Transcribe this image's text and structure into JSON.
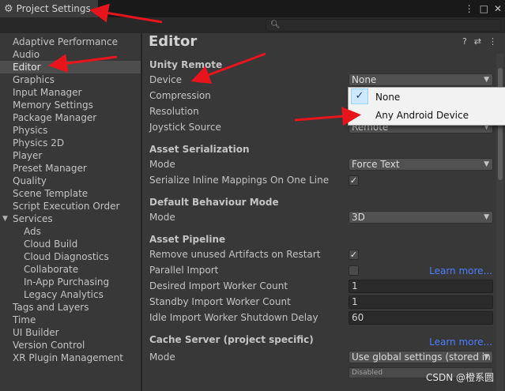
{
  "window": {
    "tab_title": "Project Settings",
    "gear_icon": "gear-icon"
  },
  "sidebar": {
    "items": [
      {
        "label": "Adaptive Performance"
      },
      {
        "label": "Audio"
      },
      {
        "label": "Editor",
        "selected": true
      },
      {
        "label": "Graphics"
      },
      {
        "label": "Input Manager"
      },
      {
        "label": "Memory Settings"
      },
      {
        "label": "Package Manager"
      },
      {
        "label": "Physics"
      },
      {
        "label": "Physics 2D"
      },
      {
        "label": "Player"
      },
      {
        "label": "Preset Manager"
      },
      {
        "label": "Quality"
      },
      {
        "label": "Scene Template"
      },
      {
        "label": "Script Execution Order"
      },
      {
        "label": "Services",
        "expanded": true
      },
      {
        "label": "Ads"
      },
      {
        "label": "Cloud Build"
      },
      {
        "label": "Cloud Diagnostics"
      },
      {
        "label": "Collaborate"
      },
      {
        "label": "In-App Purchasing"
      },
      {
        "label": "Legacy Analytics"
      },
      {
        "label": "Tags and Layers"
      },
      {
        "label": "Time"
      },
      {
        "label": "UI Builder"
      },
      {
        "label": "Version Control"
      },
      {
        "label": "XR Plugin Management"
      }
    ]
  },
  "main": {
    "title": "Editor",
    "unity_remote": {
      "header": "Unity Remote",
      "device_label": "Device",
      "device_value": "None",
      "compression_label": "Compression",
      "resolution_label": "Resolution",
      "joystick_label": "Joystick Source",
      "joystick_value": "Remote"
    },
    "asset_serialization": {
      "header": "Asset Serialization",
      "mode_label": "Mode",
      "mode_value": "Force Text",
      "inline_label": "Serialize Inline Mappings On One Line",
      "inline_checked": true
    },
    "default_behaviour": {
      "header": "Default Behaviour Mode",
      "mode_label": "Mode",
      "mode_value": "3D"
    },
    "asset_pipeline": {
      "header": "Asset Pipeline",
      "remove_label": "Remove unused Artifacts on Restart",
      "remove_checked": true,
      "parallel_label": "Parallel Import",
      "parallel_checked": false,
      "learn_more": "Learn more...",
      "desired_label": "Desired Import Worker Count",
      "desired_value": "1",
      "standby_label": "Standby Import Worker Count",
      "standby_value": "1",
      "idle_label": "Idle Import Worker Shutdown Delay",
      "idle_value": "60"
    },
    "cache_server": {
      "header": "Cache Server (project specific)",
      "learn_more": "Learn more...",
      "mode_label": "Mode",
      "mode_value": "Use global settings (stored in",
      "disabled_text": "Disabled"
    }
  },
  "device_popup": {
    "options": [
      "None",
      "Any Android Device"
    ],
    "checked": "None"
  },
  "watermark": "CSDN @橙系圆",
  "annotation_color": "#e8141c"
}
